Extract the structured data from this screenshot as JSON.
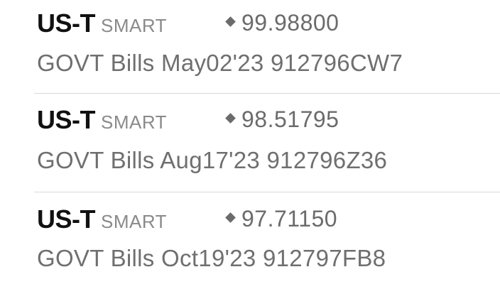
{
  "rows": [
    {
      "symbol": "US-T",
      "exchange": "SMART",
      "price": "99.98800",
      "description": "GOVT Bills May02'23 912796CW7"
    },
    {
      "symbol": "US-T",
      "exchange": "SMART",
      "price": "98.51795",
      "description": "GOVT Bills Aug17'23 912796Z36"
    },
    {
      "symbol": "US-T",
      "exchange": "SMART",
      "price": "97.71150",
      "description": "GOVT Bills Oct19'23 912797FB8"
    }
  ],
  "price_marker_icon": "diamond-icon",
  "colors": {
    "symbol": "#111111",
    "secondary_text": "#6f6f6f",
    "exchange": "#8a8a8a",
    "divider": "#d9d9d9"
  }
}
